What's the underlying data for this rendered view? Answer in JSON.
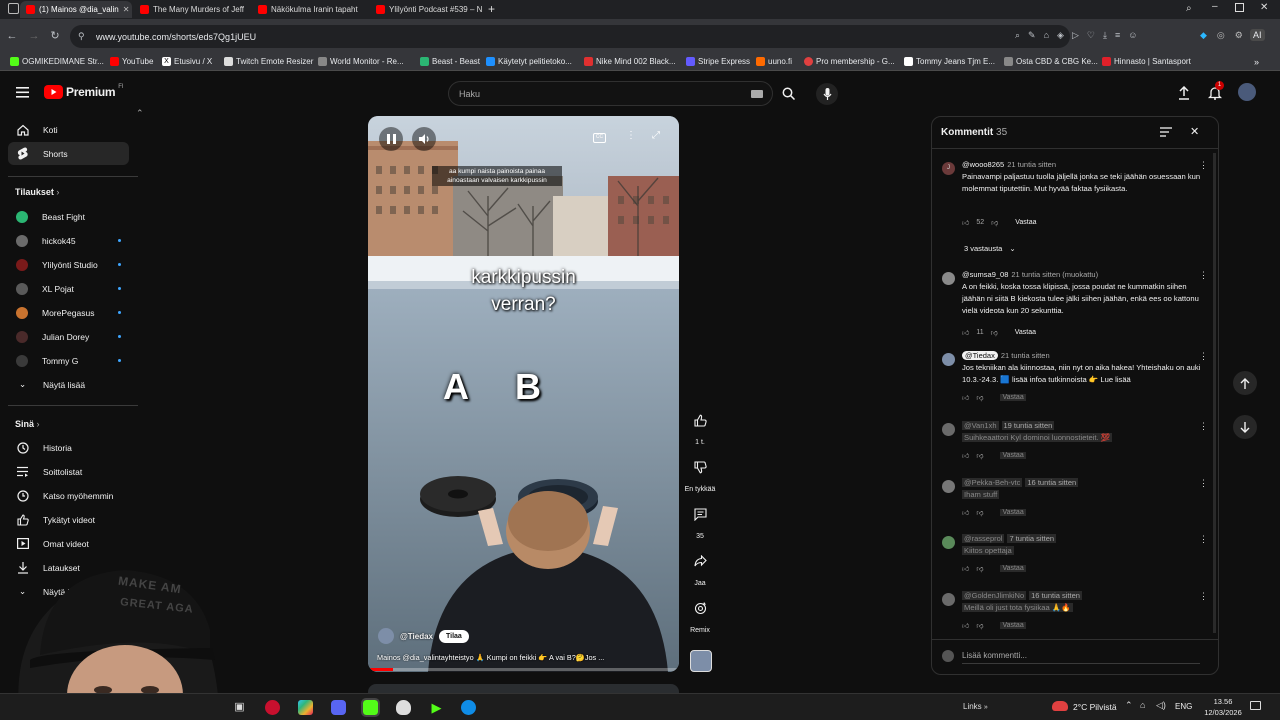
{
  "browser": {
    "tabs": [
      {
        "title": "(1) Mainos @dia_valin",
        "active": true,
        "color": "#ff0000"
      },
      {
        "title": "The Many Murders of Jeff",
        "active": false,
        "color": "#ff0000"
      },
      {
        "title": "Näkökulma Iranin tapaht",
        "active": false,
        "color": "#ff0000"
      },
      {
        "title": "Ylilyönti Podcast #539 – N",
        "active": false,
        "color": "#ff0000"
      }
    ],
    "url": "www.youtube.com/shorts/eds7Qg1jUEU",
    "bookmarks": [
      {
        "label": "OGMIKEDIMANE Str...",
        "color": "#53fc18"
      },
      {
        "label": "YouTube",
        "color": "#ff0000"
      },
      {
        "label": "Etusivu / X",
        "color": "#ffffff"
      },
      {
        "label": "Twitch Emote Resizer",
        "color": "#ffffff"
      },
      {
        "label": "World Monitor - Re...",
        "color": "#aaaaaa"
      },
      {
        "label": "Beast - Beast",
        "color": "#2bb673"
      },
      {
        "label": "Käytetyt pelitietoko...",
        "color": "#1e90ff"
      },
      {
        "label": "Nike Mind 002 Black...",
        "color": "#e03030"
      },
      {
        "label": "Stripe Express",
        "color": "#635bff"
      },
      {
        "label": "uuno.fi",
        "color": "#ff6a00"
      },
      {
        "label": "Pro membership - G...",
        "color": "#e04040"
      },
      {
        "label": "Tommy Jeans Tjm E...",
        "color": "#ffffff"
      },
      {
        "label": "Osta CBD & CBG Ke...",
        "color": "#888888"
      },
      {
        "label": "Hinnasto | Santasport",
        "color": "#e0202a"
      }
    ]
  },
  "youtube": {
    "logo": "Premium",
    "logo_region": "FI",
    "search_placeholder": "Haku"
  },
  "sidebar": {
    "top": [
      {
        "label": "Koti",
        "icon": "home-icon"
      },
      {
        "label": "Shorts",
        "icon": "shorts-icon",
        "selected": true
      }
    ],
    "subs_header": "Tilaukset",
    "subs": [
      {
        "label": "Beast Fight",
        "color": "#2bb673",
        "dot": false
      },
      {
        "label": "hickok45",
        "color": "#6b6b6b",
        "dot": true
      },
      {
        "label": "Ylilyönti Studio",
        "color": "#7a1a1a",
        "dot": true
      },
      {
        "label": "XL Pojat",
        "color": "#5a5a5a",
        "dot": true
      },
      {
        "label": "MorePegasus",
        "color": "#c9732f",
        "dot": true
      },
      {
        "label": "Julian Dorey",
        "color": "#4a2a2a",
        "dot": true
      },
      {
        "label": "Tommy G",
        "color": "#3a3a3a",
        "dot": true
      }
    ],
    "subs_more": "Näytä lisää",
    "you_header": "Sinä",
    "you": [
      {
        "label": "Historia",
        "icon": "history-icon"
      },
      {
        "label": "Soittolistat",
        "icon": "playlists-icon"
      },
      {
        "label": "Katso myöhemmin",
        "icon": "watch-later-icon"
      },
      {
        "label": "Tykätyt videot",
        "icon": "liked-icon"
      },
      {
        "label": "Omat videot",
        "icon": "my-videos-icon"
      },
      {
        "label": "Lataukset",
        "icon": "downloads-icon"
      },
      {
        "label": "Näytä lisää",
        "icon": "chevron-down-icon"
      }
    ]
  },
  "video": {
    "caption_small": "aa kumpi naista painoista painaa ainoastaan valvaisen karkkipussin",
    "caption_big_1": "karkkipussin",
    "caption_big_2": "verran?",
    "label_a": "A",
    "label_b": "B",
    "channel": "@Tiedax",
    "subscribe": "Tilaa",
    "description": "Mainos @dia_valintayhteistyo 🙏 Kumpi on feikki 👉 A vai B?🤔Jos ..."
  },
  "actions": {
    "likes": "1 t.",
    "dislike": "En tykkää",
    "comments": "35",
    "share": "Jaa",
    "remix": "Remix"
  },
  "comments_panel": {
    "title": "Kommentit",
    "count": "35",
    "add_placeholder": "Lisää kommentti...",
    "items": [
      {
        "author": "@wooo8265",
        "time": "21 tuntia sitten",
        "text": "Painavampi paljastuu tuolla jäljellä jonka se teki jäähän osuessaan kun molemmat tiputettiin. Mut hyvää faktaa fysiikasta.",
        "likes": "52",
        "reply": "Vastaa",
        "replies": "3 vastausta",
        "color": "#6b3a3a"
      },
      {
        "author": "@sumsa9_08",
        "time": "21 tuntia sitten (muokattu)",
        "text": "A on feikki, koska tossa klipissä, jossa poudat ne kummatkin siihen jäähän ni siitä B kiekosta tulee jälki siihen jäähän, enkä ees oo kattonu vielä videota kun 20 sekunttia.",
        "likes": "11",
        "reply": "Vastaa",
        "color": "#8a8a8a"
      },
      {
        "author": "@Tiedax",
        "time": "21 tuntia sitten",
        "text": "Jos tekniikan ala kiinnostaa, niin nyt on aika hakea! Yhteishaku on auki 10.3.-24.3. 🟦 lisää infoa tutkinnoista 👉 Lue lisää",
        "likes": "",
        "reply": "Vastaa",
        "color": "#7d8ea8"
      },
      {
        "author": "@Van1xh",
        "time": "19 tuntia sitten",
        "text": "Suihkeaattori Kyl dominoi luonnostieteit. 💯",
        "likes": "",
        "reply": "Vastaa",
        "color": "#6a6a6a"
      },
      {
        "author": "@Pekka-Beh-vtc",
        "time": "16 tuntia sitten",
        "text": "Iham stuff",
        "likes": "",
        "reply": "Vastaa",
        "color": "#777777"
      },
      {
        "author": "@rasseprol",
        "time": "7 tuntia sitten",
        "text": "Kiitos opettaja",
        "likes": "",
        "reply": "Vastaa",
        "color": "#5a8a5a"
      },
      {
        "author": "@GoldenJlimkiNo",
        "time": "16 tuntia sitten",
        "text": "Meillä oli just tota fysiikaa 🙏🔥",
        "likes": "",
        "reply": "Vastaa",
        "color": "#6a6a6a"
      }
    ]
  },
  "taskbar": {
    "links": "Links",
    "weather": "2°C Pilvistä",
    "lang": "ENG",
    "time": "13.56",
    "date": "12/03/2026"
  },
  "webcam": {
    "cap_text_1": "MAKE AM",
    "cap_text_2": "GREAT AGA"
  }
}
